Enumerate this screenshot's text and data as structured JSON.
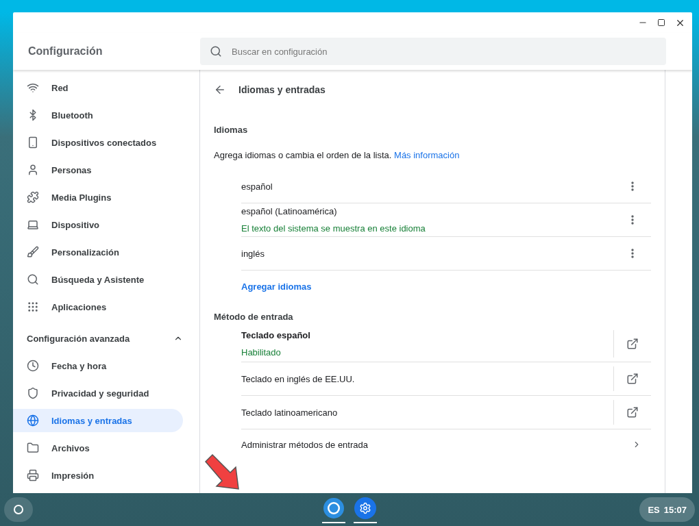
{
  "window": {
    "title": "Configuración"
  },
  "search": {
    "placeholder": "Buscar en configuración"
  },
  "sidebar": {
    "items": [
      {
        "label": "Red",
        "selected": false
      },
      {
        "label": "Bluetooth",
        "selected": false
      },
      {
        "label": "Dispositivos conectados",
        "selected": false
      },
      {
        "label": "Personas",
        "selected": false
      },
      {
        "label": "Media Plugins",
        "selected": false
      },
      {
        "label": "Dispositivo",
        "selected": false
      },
      {
        "label": "Personalización",
        "selected": false
      },
      {
        "label": "Búsqueda y Asistente",
        "selected": false
      },
      {
        "label": "Aplicaciones",
        "selected": false
      }
    ],
    "advanced": {
      "label": "Configuración avanzada",
      "expanded": true,
      "items": [
        {
          "label": "Fecha y hora",
          "selected": false
        },
        {
          "label": "Privacidad y seguridad",
          "selected": false
        },
        {
          "label": "Idiomas y entradas",
          "selected": true
        },
        {
          "label": "Archivos",
          "selected": false
        },
        {
          "label": "Impresión",
          "selected": false
        }
      ]
    }
  },
  "page": {
    "title": "Idiomas y entradas",
    "languages": {
      "heading": "Idiomas",
      "description": "Agrega idiomas o cambia el orden de la lista.",
      "link": "Más información",
      "items": [
        {
          "name": "español"
        },
        {
          "name": "español (Latinoamérica)",
          "note": "El texto del sistema se muestra en este idioma"
        },
        {
          "name": "inglés"
        }
      ],
      "add": "Agregar idiomas"
    },
    "input_methods": {
      "heading": "Método de entrada",
      "items": [
        {
          "name": "Teclado español",
          "current": true,
          "status": "Habilitado"
        },
        {
          "name": "Teclado en inglés de EE.UU.",
          "current": false
        },
        {
          "name": "Teclado latinoamericano",
          "current": false
        }
      ],
      "manage": "Administrar métodos de entrada"
    }
  },
  "shelf": {
    "apps": [
      {
        "kind": "browser",
        "running": true
      },
      {
        "kind": "settings",
        "running": true
      }
    ],
    "status": {
      "language": "ES",
      "time": "15:07"
    }
  }
}
